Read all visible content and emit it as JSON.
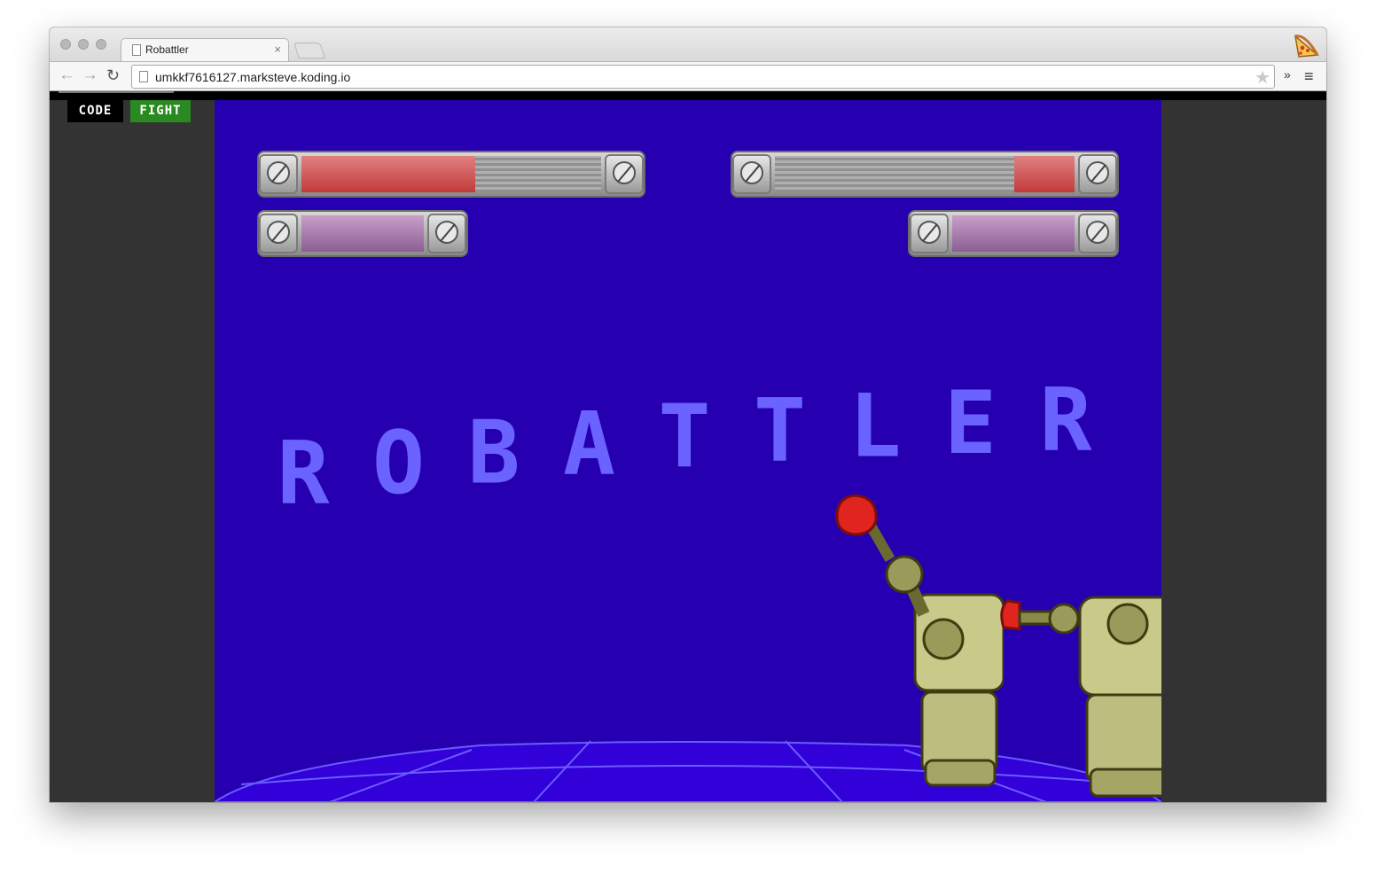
{
  "browser": {
    "tab_title": "Robattler",
    "tab_close": "×",
    "url": "umkkf7616127.marksteve.koding.io",
    "back_icon": "←",
    "forward_icon": "→",
    "reload_icon": "↻",
    "star_icon": "★",
    "extensions_icon": "»",
    "menu_icon": "≡"
  },
  "app": {
    "code_button": "CODE",
    "fight_button": "FIGHT",
    "accent_colors": {
      "stage": "#2600b0",
      "fight": "#2a8a22",
      "health": "#c23a3a",
      "energy": "#8c5e95"
    }
  },
  "game": {
    "title_letters": [
      "R",
      "O",
      "B",
      "A",
      "T",
      "T",
      "L",
      "E",
      "R"
    ],
    "player1": {
      "health": 0.58,
      "energy": 1.0
    },
    "player2": {
      "health": 0.2,
      "energy": 1.0
    }
  }
}
